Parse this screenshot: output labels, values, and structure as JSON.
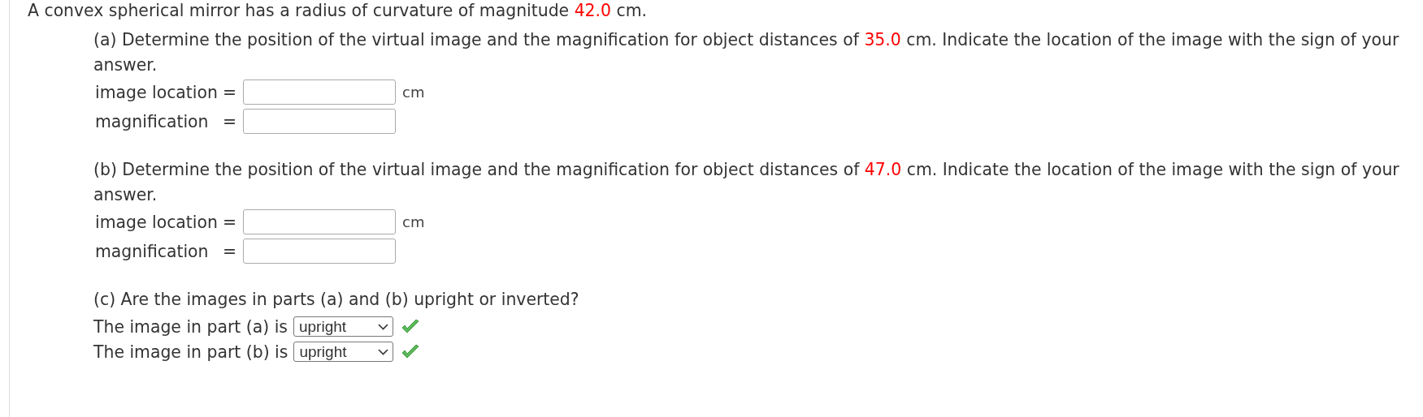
{
  "intro": [
    {
      "kind": "plain",
      "text": "A convex spherical mirror has a radius of curvature of magnitude "
    },
    {
      "kind": "given",
      "text": "42.0"
    },
    {
      "kind": "plain",
      "text": " cm."
    }
  ],
  "parts": [
    {
      "kind": "numeric",
      "prompt": [
        {
          "kind": "plain",
          "text": "(a) Determine the position of the virtual image and the magnification for object distances of "
        },
        {
          "kind": "given",
          "text": "35.0"
        },
        {
          "kind": "plain",
          "text": " cm. Indicate the location of the image with the sign of your answer."
        }
      ],
      "fields": [
        {
          "label": "image location",
          "equals": "=",
          "unit": "cm"
        },
        {
          "label": "magnification",
          "equals": "="
        }
      ]
    },
    {
      "kind": "numeric",
      "prompt": [
        {
          "kind": "plain",
          "text": "(b) Determine the position of the virtual image and the magnification for object distances of "
        },
        {
          "kind": "given",
          "text": "47.0"
        },
        {
          "kind": "plain",
          "text": " cm. Indicate the location of the image with the sign of your answer."
        }
      ],
      "fields": [
        {
          "label": "image location",
          "equals": "=",
          "unit": "cm"
        },
        {
          "label": "magnification",
          "equals": "="
        }
      ]
    },
    {
      "kind": "choice",
      "prompt": [
        {
          "kind": "plain",
          "text": "(c) Are the images in parts (a) and (b) upright or inverted?"
        }
      ],
      "choices": [
        {
          "label": "The image in part (a) is",
          "value": "upright",
          "correct": true
        },
        {
          "label": "The image in part (b) is",
          "value": "upright",
          "correct": true
        }
      ]
    }
  ]
}
